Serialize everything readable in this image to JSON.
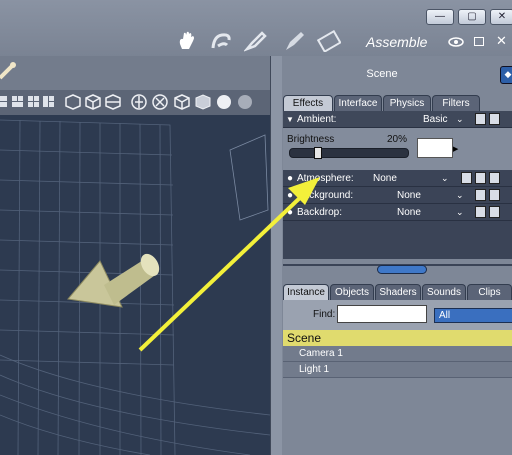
{
  "window": {
    "minimize_label": "—",
    "maximize_label": "▢",
    "close_label": "✕"
  },
  "toolbar": {
    "room_title": "Assemble"
  },
  "panel": {
    "title": "Scene"
  },
  "effects_tabs": [
    "Effects",
    "Interface",
    "Physics",
    "Filters"
  ],
  "ambient": {
    "label": "Ambient:",
    "value": "Basic"
  },
  "brightness": {
    "label": "Brightness",
    "percent": "20%",
    "level": 0.2
  },
  "atmosphere": {
    "label": "Atmosphere:",
    "value": "None"
  },
  "background": {
    "label": "Background:",
    "value": "None"
  },
  "backdrop": {
    "label": "Backdrop:",
    "value": "None"
  },
  "instance_tabs": [
    "Instance",
    "Objects",
    "Shaders",
    "Sounds",
    "Clips"
  ],
  "find": {
    "label": "Find:",
    "value": "",
    "filter": "All"
  },
  "tree": {
    "root": "Scene",
    "items": [
      "Camera 1",
      "Light 1"
    ]
  },
  "colors": {
    "highlight_row": "#e0db6e",
    "arrow": "#f3f03a",
    "viewport_bg": "#2d3a50"
  }
}
